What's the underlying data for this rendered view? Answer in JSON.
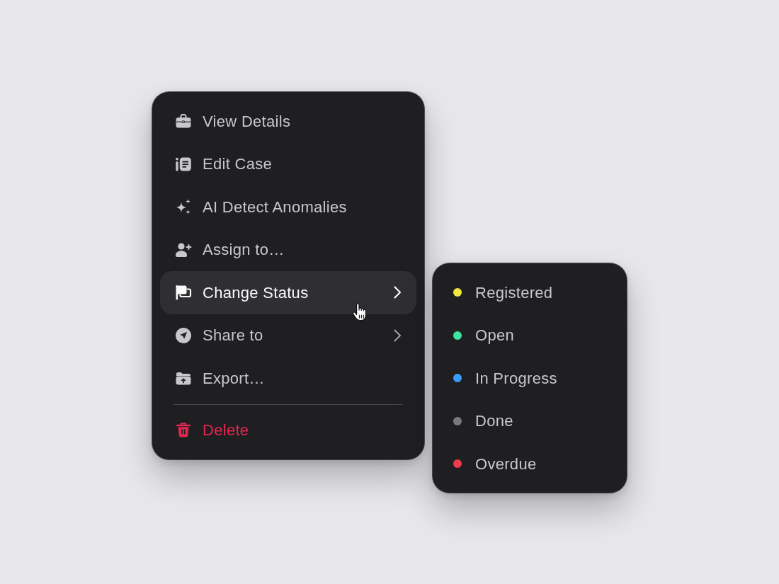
{
  "menu": {
    "items": [
      {
        "kind": "action",
        "label": "View Details",
        "highlighted": false,
        "submenu": false
      },
      {
        "kind": "action",
        "label": "Edit Case",
        "highlighted": false,
        "submenu": false
      },
      {
        "kind": "action",
        "label": "AI Detect Anomalies",
        "highlighted": false,
        "submenu": false
      },
      {
        "kind": "action",
        "label": "Assign to…",
        "highlighted": false,
        "submenu": false
      },
      {
        "kind": "action",
        "label": "Change Status",
        "highlighted": true,
        "submenu": true
      },
      {
        "kind": "action",
        "label": "Share to",
        "highlighted": false,
        "submenu": true
      },
      {
        "kind": "action",
        "label": "Export…",
        "highlighted": false,
        "submenu": false
      },
      {
        "kind": "danger",
        "label": "Delete",
        "highlighted": false,
        "submenu": false
      }
    ]
  },
  "status_menu": {
    "items": [
      {
        "label": "Registered",
        "color": "#f2e93c"
      },
      {
        "label": "Open",
        "color": "#3de59e"
      },
      {
        "label": "In Progress",
        "color": "#3b9bf6"
      },
      {
        "label": "Done",
        "color": "#7a797d"
      },
      {
        "label": "Overdue",
        "color": "#ee3b50"
      }
    ]
  }
}
